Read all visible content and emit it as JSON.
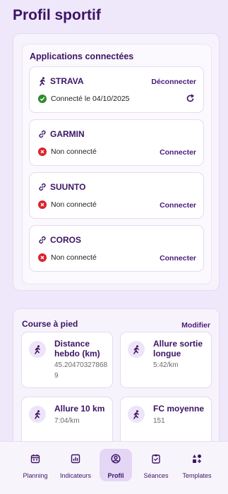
{
  "page": {
    "title": "Profil sportif"
  },
  "apps": {
    "title": "Applications connectées",
    "items": [
      {
        "name": "STRAVA",
        "icon": "running-icon",
        "status": "Connecté le 04/10/2025",
        "connected": true,
        "action": "Déconnecter",
        "refresh": true
      },
      {
        "name": "GARMIN",
        "icon": "link-icon",
        "status": "Non connecté",
        "connected": false,
        "action": "Connecter"
      },
      {
        "name": "SUUNTO",
        "icon": "link-icon",
        "status": "Non connecté",
        "connected": false,
        "action": "Connecter"
      },
      {
        "name": "COROS",
        "icon": "link-icon",
        "status": "Non connecté",
        "connected": false,
        "action": "Connecter"
      }
    ]
  },
  "running": {
    "title": "Course à pied",
    "edit_label": "Modifier",
    "stats": [
      {
        "label": "Distance hebdo (km)",
        "value": "45.204703278689"
      },
      {
        "label": "Allure sortie longue",
        "value": "5:42/km"
      },
      {
        "label": "Allure 10 km",
        "value": "7:04/km"
      },
      {
        "label": "FC moyenne",
        "value": "151"
      }
    ]
  },
  "nav": {
    "items": [
      {
        "label": "Planning",
        "icon": "calendar-icon",
        "active": false
      },
      {
        "label": "Indicateurs",
        "icon": "chart-icon",
        "active": false
      },
      {
        "label": "Profil",
        "icon": "profile-icon",
        "active": true
      },
      {
        "label": "Séances",
        "icon": "clipboard-icon",
        "active": false
      },
      {
        "label": "Templates",
        "icon": "templates-icon",
        "active": false
      }
    ]
  },
  "colors": {
    "accent": "#3c1464",
    "background": "#efe7fa",
    "connected": "#2e8a2e",
    "disconnected": "#d9232e"
  }
}
